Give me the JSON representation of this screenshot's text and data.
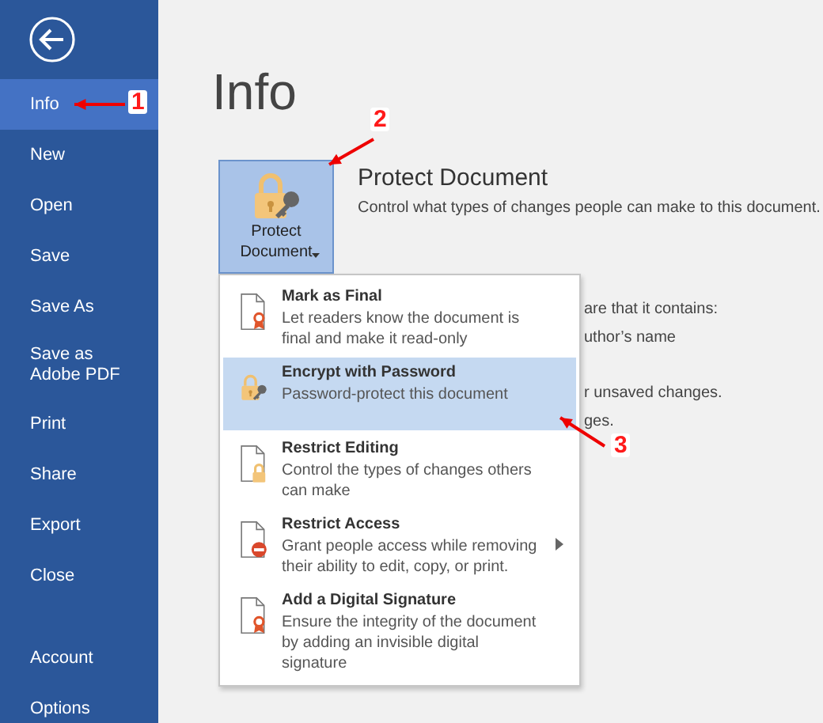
{
  "sidebar": {
    "items": [
      {
        "label": "Info",
        "selected": true
      },
      {
        "label": "New",
        "selected": false
      },
      {
        "label": "Open",
        "selected": false
      },
      {
        "label": "Save",
        "selected": false
      },
      {
        "label": "Save As",
        "selected": false
      },
      {
        "label": "Save as Adobe PDF",
        "selected": false
      },
      {
        "label": "Print",
        "selected": false
      },
      {
        "label": "Share",
        "selected": false
      },
      {
        "label": "Export",
        "selected": false
      },
      {
        "label": "Close",
        "selected": false
      }
    ],
    "bottom_items": [
      {
        "label": "Account",
        "selected": false
      },
      {
        "label": "Options",
        "selected": false
      }
    ]
  },
  "page_title": "Info",
  "protect": {
    "button_label": "Protect Document",
    "title": "Protect Document",
    "description": "Control what types of changes people can make to this document."
  },
  "background_fragments": [
    {
      "text": "are that it contains:"
    },
    {
      "text": "uthor’s name"
    },
    {
      "text": "r unsaved changes."
    },
    {
      "text": "ges."
    }
  ],
  "menu": {
    "items": [
      {
        "kind": "final",
        "title": "Mark as Final",
        "description": "Let readers know the document is final and make it read-only",
        "selected": false,
        "submenu": false
      },
      {
        "kind": "encrypt",
        "title": "Encrypt with Password",
        "description": "Password-protect this document",
        "selected": true,
        "submenu": false
      },
      {
        "kind": "restrict-editing",
        "title": "Restrict Editing",
        "description": "Control the types of changes others can make",
        "selected": false,
        "submenu": false
      },
      {
        "kind": "restrict-access",
        "title": "Restrict Access",
        "description": "Grant people access while removing their ability to edit, copy, or print.",
        "selected": false,
        "submenu": true
      },
      {
        "kind": "signature",
        "title": "Add a Digital Signature",
        "description": "Ensure the integrity of the document by adding an invisible digital signature",
        "selected": false,
        "submenu": false
      }
    ]
  },
  "annotations": [
    {
      "label": "1"
    },
    {
      "label": "2"
    },
    {
      "label": "3"
    }
  ]
}
